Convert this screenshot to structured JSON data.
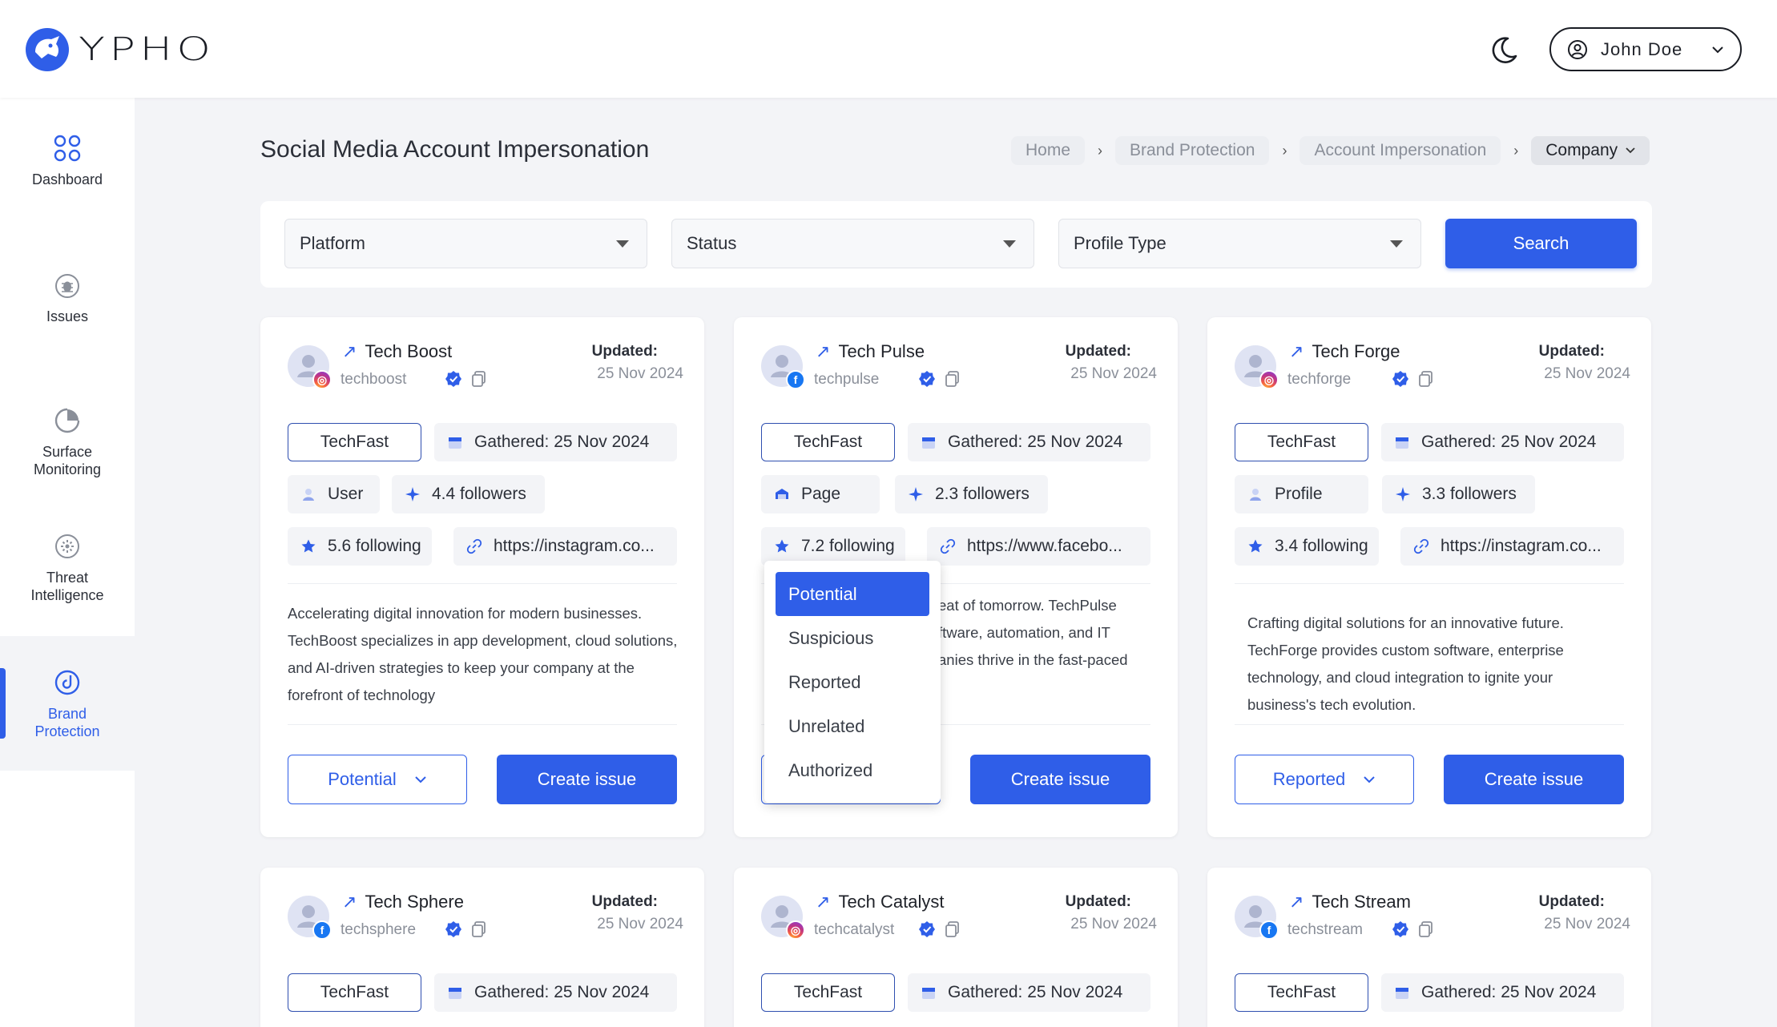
{
  "app": {
    "brand": "YPHO"
  },
  "header": {
    "user_name": "John Doe"
  },
  "sidebar": {
    "items": [
      {
        "label": "Dashboard",
        "icon": "grid-icon"
      },
      {
        "label": "Issues",
        "icon": "bug-icon"
      },
      {
        "label": "Surface Monitoring",
        "icon": "radar-icon"
      },
      {
        "label": "Threat Intelligence",
        "icon": "intel-icon"
      },
      {
        "label": "Brand Protection",
        "icon": "brand-protection-icon",
        "active": true
      }
    ]
  },
  "page": {
    "title": "Social Media Account Impersonation"
  },
  "breadcrumb": [
    "Home",
    "Brand Protection",
    "Account Impersonation",
    "Company"
  ],
  "filters": {
    "platform": "Platform",
    "status": "Status",
    "profile_type": "Profile Type",
    "search": "Search"
  },
  "common": {
    "updated_label": "Updated:",
    "create_issue": "Create issue"
  },
  "cards": [
    {
      "name": "Tech Boost",
      "handle": "techboost",
      "platform": "instagram",
      "updated": "25 Nov 2024",
      "tag": "TechFast",
      "gathered": "Gathered: 25 Nov 2024",
      "profile": "User",
      "followers": "4.4 followers",
      "following": "5.6 following",
      "url": "https://instagram.co...",
      "desc": "Accelerating digital innovation for modern businesses. TechBoost specializes in app development, cloud solutions, and AI-driven strategies to keep your company at the forefront of technology",
      "status": "Potential"
    },
    {
      "name": "Tech Pulse",
      "handle": "techpulse",
      "platform": "facebook",
      "updated": "25 Nov 2024",
      "tag": "TechFast",
      "gathered": "Gathered: 25 Nov 2024",
      "profile": "Page",
      "followers": "2.3 followers",
      "following": "7.2 following",
      "url": "https://www.facebo...",
      "desc_lines": [
        "eat of tomorrow. TechPulse",
        "ftware, automation, and IT",
        "anies thrive in the fast-paced"
      ],
      "status": ""
    },
    {
      "name": "Tech Forge",
      "handle": "techforge",
      "platform": "instagram",
      "updated": "25 Nov 2024",
      "tag": "TechFast",
      "gathered": "Gathered: 25 Nov 2024",
      "profile": "Profile",
      "followers": "3.3 followers",
      "following": "3.4 following",
      "url": "https://instagram.co...",
      "desc": "Crafting digital solutions for an innovative future. TechForge provides custom software, enterprise technology, and cloud integration to ignite your business's tech evolution.",
      "status": "Reported"
    },
    {
      "name": "Tech Sphere",
      "handle": "techsphere",
      "platform": "facebook",
      "updated": "25 Nov 2024",
      "tag": "TechFast",
      "gathered": "Gathered: 25 Nov 2024"
    },
    {
      "name": "Tech Catalyst",
      "handle": "techcatalyst",
      "platform": "instagram",
      "updated": "25 Nov 2024",
      "tag": "TechFast",
      "gathered": "Gathered: 25 Nov 2024"
    },
    {
      "name": "Tech Stream",
      "handle": "techstream",
      "platform": "facebook",
      "updated": "25 Nov 2024",
      "tag": "TechFast",
      "gathered": "Gathered: 25 Nov 2024"
    }
  ],
  "status_dropdown": {
    "options": [
      "Potential",
      "Suspicious",
      "Reported",
      "Unrelated",
      "Authorized"
    ],
    "selected": "Potential"
  },
  "colors": {
    "primary": "#2f5ee8",
    "background": "#f3f4f7"
  }
}
